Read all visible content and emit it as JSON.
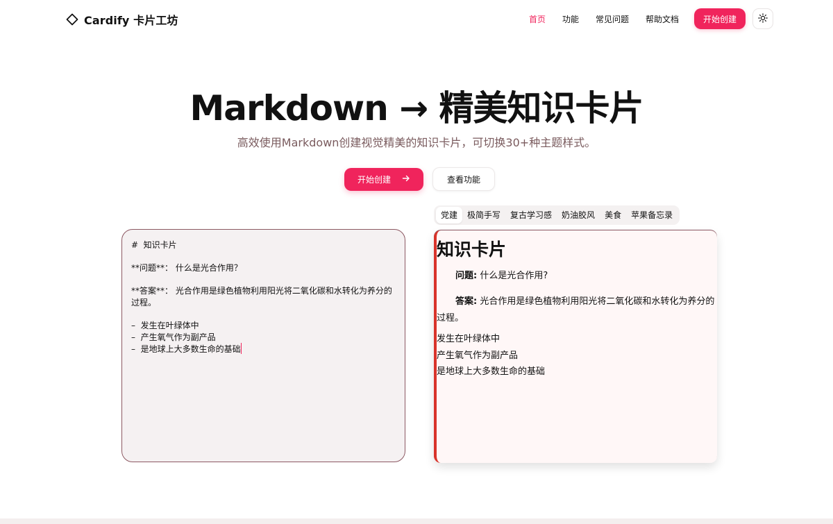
{
  "header": {
    "logo_text": "Cardify 卡片工坊",
    "nav": {
      "home": "首页",
      "features": "功能",
      "faq": "常见问题",
      "docs": "帮助文档"
    },
    "cta_label": "开始创建",
    "theme_toggle_icon": "sun-icon"
  },
  "hero": {
    "title": "Markdown → 精美知识卡片",
    "subtitle": "高效使用Markdown创建视觉精美的知识卡片，可切换30+种主题样式。",
    "primary_button": "开始创建",
    "primary_button_icon": "arrow-right-icon",
    "secondary_button": "查看功能"
  },
  "editor": {
    "lines": [
      "#  知识卡片",
      "",
      "**问题**： 什么是光合作用？",
      "",
      "**答案**： 光合作用是绿色植物利用阳光将二氧化碳和水转化为养分的",
      "过程。",
      "",
      "–  发生在叶绿体中",
      "–  产生氧气作为副产品",
      "–  是地球上大多数生命的基础"
    ]
  },
  "themes": {
    "tabs": [
      "党建",
      "极简手写",
      "复古学习感",
      "奶油胶风",
      "美食",
      "苹果备忘录"
    ],
    "active": "党建"
  },
  "preview": {
    "title": "知识卡片",
    "question_label": "问题:",
    "question_text": " 什么是光合作用?",
    "answer_label": "答案:",
    "answer_text": " 光合作用是绿色植物利用阳光将二氧化碳和水转化为养分的过程。",
    "bullets": [
      "发生在叶绿体中",
      "产生氧气作为副产品",
      "是地球上大多数生命的基础"
    ]
  },
  "colors": {
    "accent": "#f0245c",
    "subtitle": "#7a5b5e",
    "editor_border": "#8c5862",
    "preview_border": "#d9342b"
  }
}
